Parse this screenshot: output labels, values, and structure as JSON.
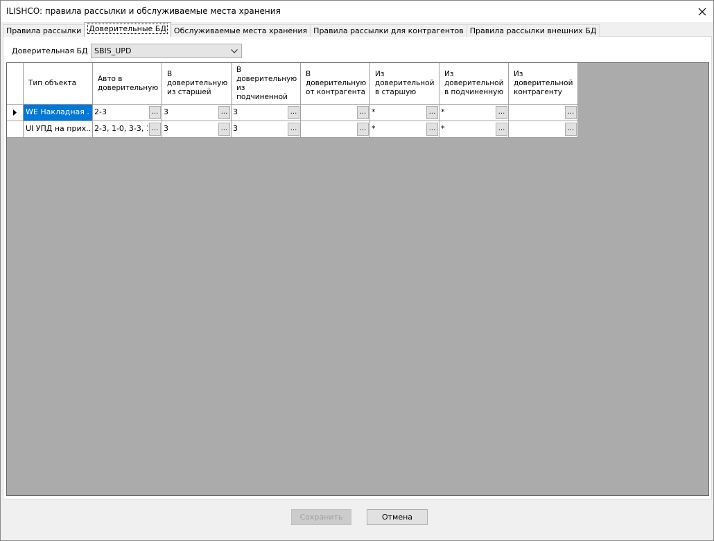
{
  "window": {
    "title": "ILISHCO: правила рассылки и обслуживаемые места хранения"
  },
  "tabs": [
    {
      "label": "Правила рассылки"
    },
    {
      "label": "Доверительные БД",
      "active": true
    },
    {
      "label": "Обслуживаемые места хранения"
    },
    {
      "label": "Правила рассылки для контрагентов"
    },
    {
      "label": "Правила рассылки внешних БД"
    }
  ],
  "db_selector": {
    "label": "Доверительная БД :",
    "value": "SBIS_UPD"
  },
  "grid": {
    "columns": [
      "Тип объекта",
      "Авто в доверительную",
      "В доверительную из старшей",
      "В доверительную из подчиненной",
      "В доверительную от контрагента",
      "Из доверительной в старшую",
      "Из доверительной в подчиненную",
      "Из доверительной контрагенту"
    ],
    "rows": [
      {
        "current": true,
        "type": "WE Накладная ...",
        "values": [
          "2-3",
          "3",
          "3",
          "",
          "*",
          "*",
          ""
        ]
      },
      {
        "current": false,
        "type": "UI УПД на прих...",
        "values": [
          "2-3, 1-0, 3-3, 1...",
          "3",
          "3",
          "",
          "*",
          "*",
          ""
        ]
      }
    ],
    "ellipsis_label": "..."
  },
  "buttons": {
    "save": "Сохранить",
    "cancel": "Отмена"
  }
}
